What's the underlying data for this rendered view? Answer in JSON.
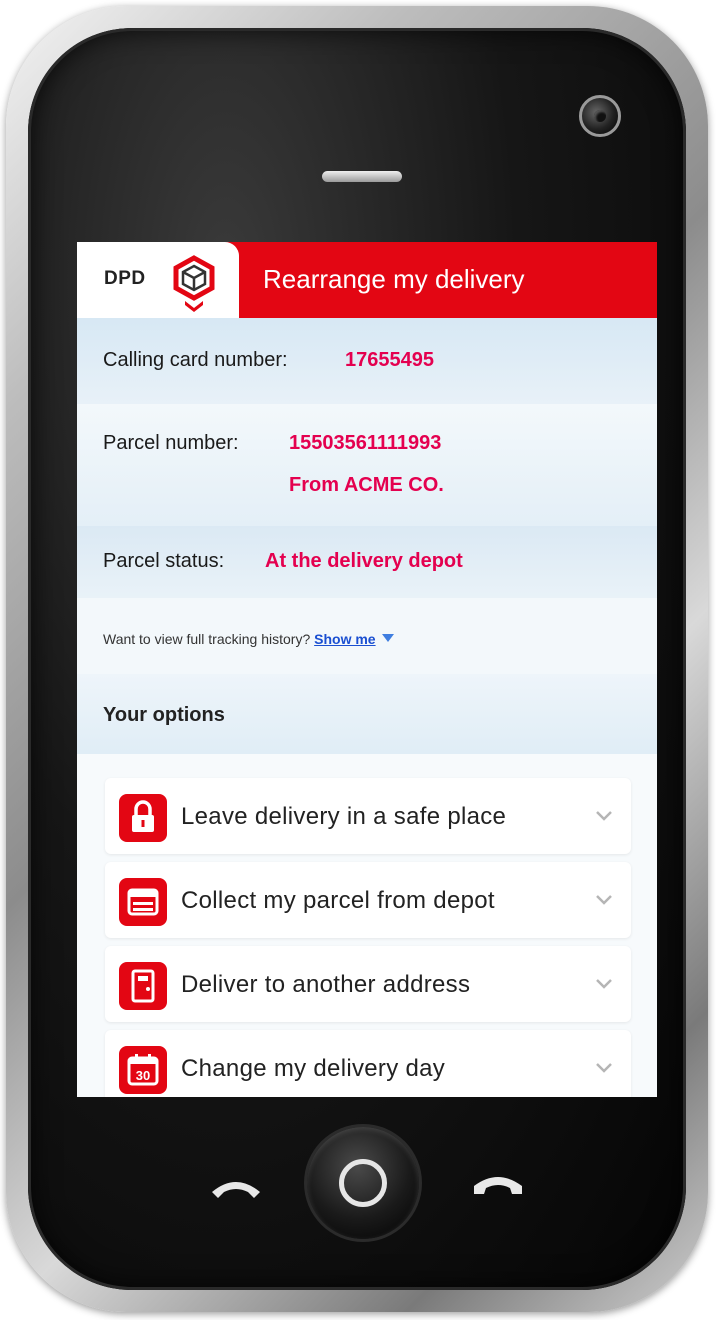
{
  "app": {
    "logo_text": "DPD",
    "title": "Rearrange my delivery"
  },
  "details": {
    "calling_card_label": "Calling card number:",
    "calling_card_value": "17655495",
    "parcel_label": "Parcel number:",
    "parcel_value": "15503561111993",
    "parcel_sender": "From ACME CO.",
    "status_label": "Parcel status:",
    "status_value": "At the delivery depot",
    "history_prompt": "Want to view full tracking history?",
    "history_link": "Show me"
  },
  "options": {
    "heading": "Your options",
    "items": [
      {
        "label": "Leave delivery in a safe place",
        "icon": "padlock-icon"
      },
      {
        "label": "Collect my parcel from depot",
        "icon": "depot-icon"
      },
      {
        "label": "Deliver to another address",
        "icon": "address-door-icon"
      },
      {
        "label": "Change my delivery day",
        "icon": "calendar-icon",
        "icon_text": "30"
      }
    ]
  },
  "colors": {
    "brand_red": "#e30613",
    "value_pink": "#e4004f",
    "link_blue": "#1a4fd1"
  }
}
